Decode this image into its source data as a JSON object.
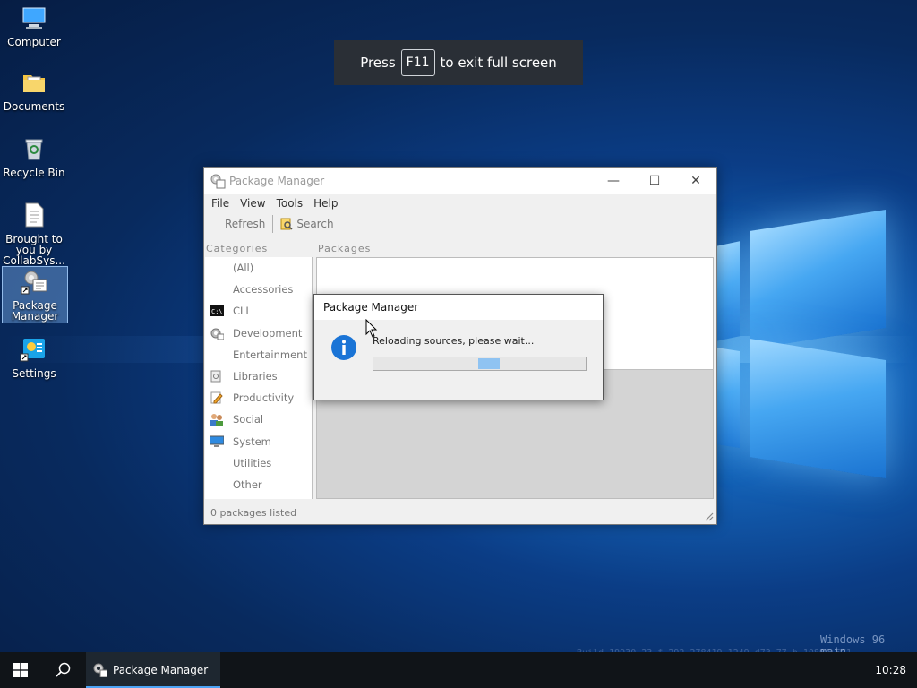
{
  "desktop": {
    "icons": [
      {
        "label": "Computer",
        "icon": "computer-icon"
      },
      {
        "label": "Documents",
        "icon": "folder-icon"
      },
      {
        "label": "Recycle Bin",
        "icon": "recycle-bin-icon"
      },
      {
        "label": "Brought to you by CollabSys...",
        "icon": "text-document-icon"
      },
      {
        "label": "Package Manager",
        "icon": "package-manager-icon"
      },
      {
        "label": "Settings",
        "icon": "settings-icon"
      }
    ]
  },
  "fullscreen_banner": {
    "press": "Press",
    "key": "F11",
    "suffix": "to exit full screen"
  },
  "window": {
    "title": "Package Manager",
    "minimize": "—",
    "maximize": "☐",
    "close": "✕",
    "menu": [
      "File",
      "View",
      "Tools",
      "Help"
    ],
    "toolbar": {
      "refresh": "Refresh",
      "search": "Search"
    },
    "categories_header": "Categories",
    "packages_header": "Packages",
    "categories": [
      {
        "label": "(All)",
        "icon": ""
      },
      {
        "label": "Accessories",
        "icon": ""
      },
      {
        "label": "CLI",
        "icon": "terminal-icon"
      },
      {
        "label": "Development",
        "icon": "gear-icon"
      },
      {
        "label": "Entertainment",
        "icon": ""
      },
      {
        "label": "Libraries",
        "icon": "library-icon"
      },
      {
        "label": "Productivity",
        "icon": "pencil-icon"
      },
      {
        "label": "Social",
        "icon": "people-icon"
      },
      {
        "label": "System",
        "icon": "monitor-icon"
      },
      {
        "label": "Utilities",
        "icon": ""
      },
      {
        "label": "Other",
        "icon": ""
      }
    ],
    "status": "0 packages listed"
  },
  "dialog": {
    "title": "Package Manager",
    "message": "Reloading sources, please wait...",
    "icon": "info-icon"
  },
  "watermark": {
    "line1": "Windows 96 main",
    "line2": "Build 19930.23.f.292-278419-1249-d73.77.b-10864-571"
  },
  "taskbar": {
    "app": "Package Manager",
    "clock": "10:28"
  }
}
